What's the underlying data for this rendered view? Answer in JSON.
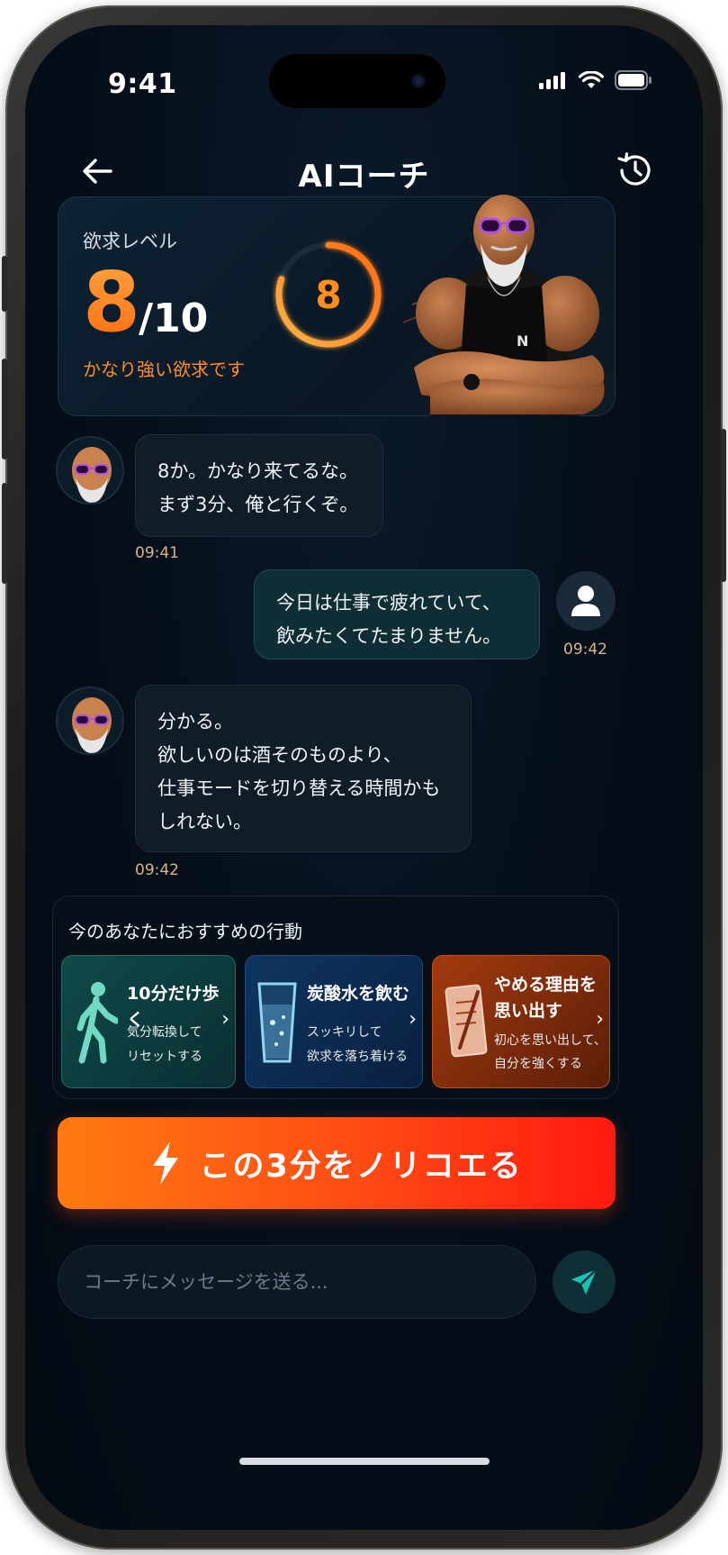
{
  "status_bar": {
    "time": "9:41"
  },
  "header": {
    "title": "AIコーチ",
    "back_icon": "arrow-left-icon",
    "history_icon": "history-clock-icon"
  },
  "craving": {
    "label": "欲求レベル",
    "value": "8",
    "max": "/10",
    "ring_value": "8",
    "level_fraction": 0.8,
    "description": "かなり強い欲求です"
  },
  "messages": [
    {
      "from": "coach",
      "lines": [
        "8か。かなり来てるな。",
        "まず3分、俺と行くぞ。"
      ],
      "time": "09:41"
    },
    {
      "from": "user",
      "lines": [
        "今日は仕事で疲れていて、",
        "飲みたくてたまりません。"
      ],
      "time": "09:42"
    },
    {
      "from": "coach",
      "lines": [
        "分かる。",
        "欲しいのは酒そのものより、",
        "仕事モードを切り替える時間かも",
        "しれない。"
      ],
      "time": "09:42"
    }
  ],
  "recommendations": {
    "title": "今のあなたにおすすめの行動",
    "items": [
      {
        "title": "10分だけ歩く",
        "desc1": "気分転換して",
        "desc2": "リセットする",
        "icon": "walking-icon"
      },
      {
        "title": "炭酸水を飲む",
        "desc1": "スッキリして",
        "desc2": "欲求を落ち着ける",
        "icon": "water-glass-icon"
      },
      {
        "title1": "やめる理由を",
        "title2": "思い出す",
        "desc1": "初心を思い出して、",
        "desc2": "自分を強くする",
        "icon": "notebook-icon"
      }
    ]
  },
  "cta": {
    "label": "この3分をノリコエる",
    "icon": "lightning-icon"
  },
  "composer": {
    "placeholder": "コーチにメッセージを送る...",
    "send_icon": "send-icon"
  },
  "colors": {
    "accent_orange": "#ff8a1c",
    "cta_start": "#ff7a12",
    "cta_end": "#ff1a10",
    "background": "#040d18"
  }
}
